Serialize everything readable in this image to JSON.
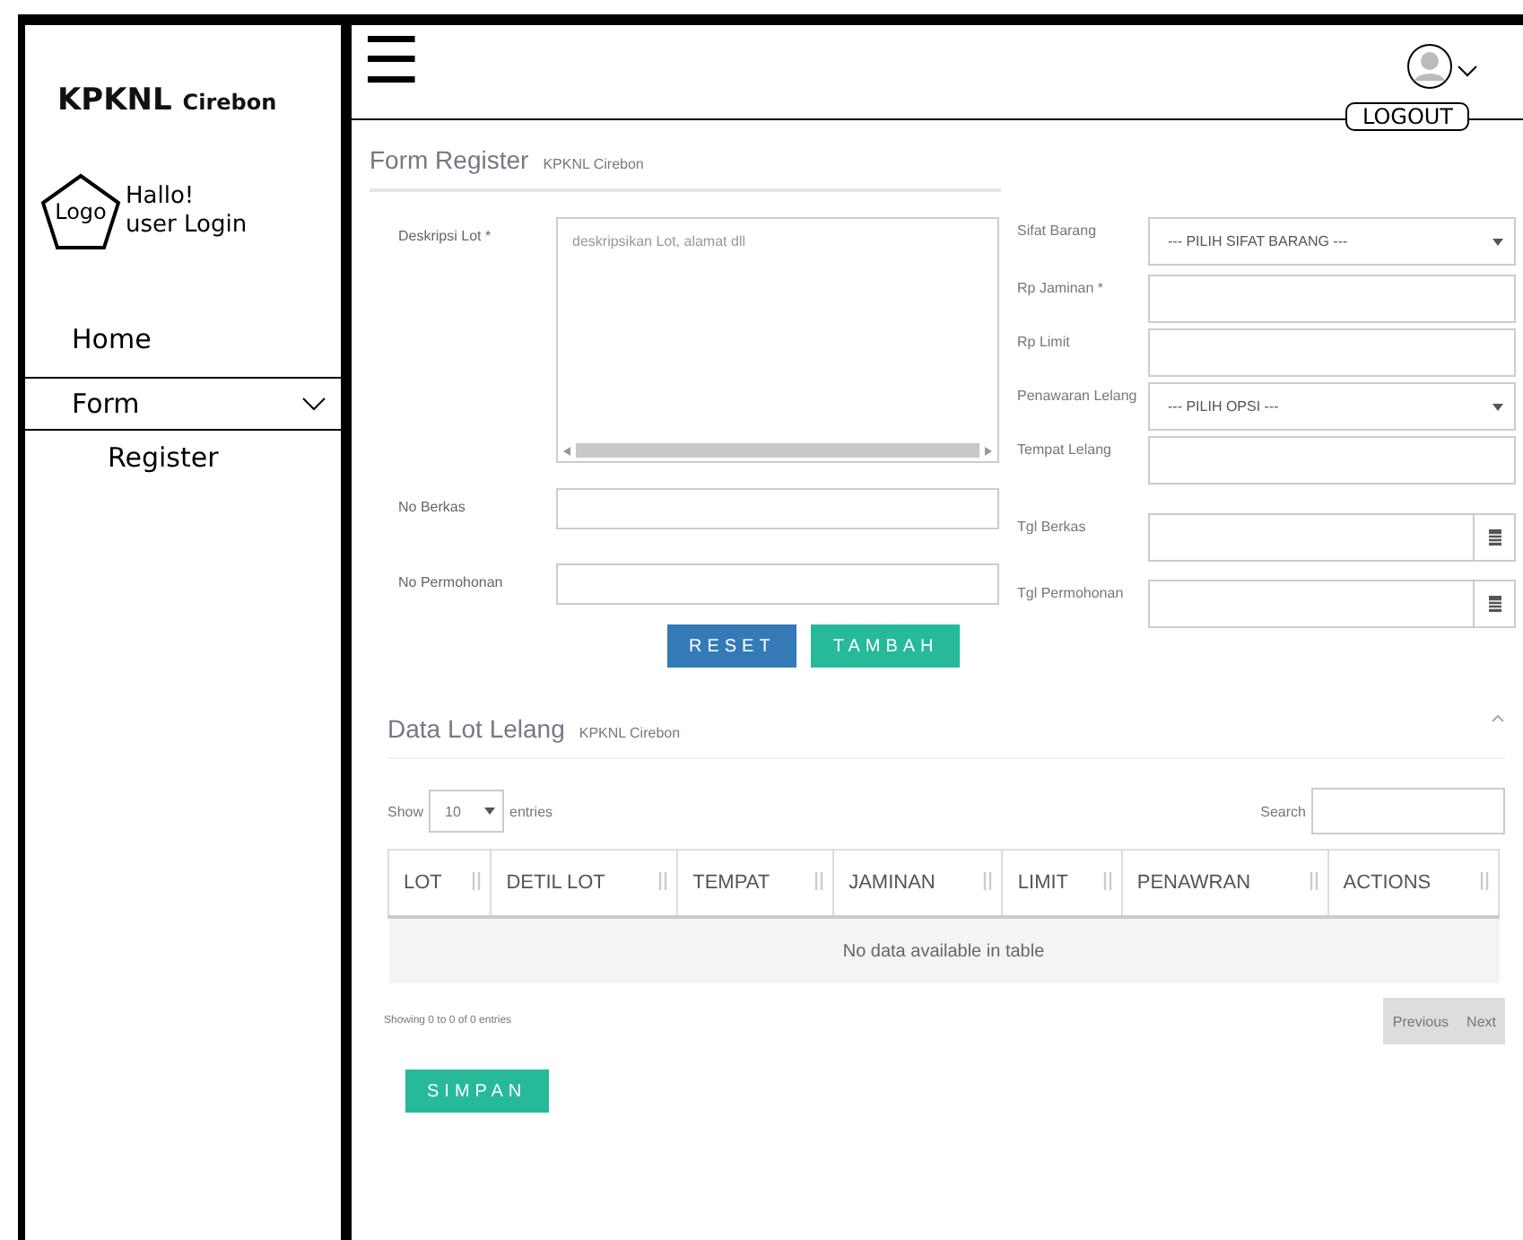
{
  "sidebar": {
    "brand": "KPKNL",
    "brand_sub": "Cirebon",
    "logo": "Logo",
    "greeting": "Hallo!",
    "user": "user Login",
    "items": [
      {
        "label": "Home",
        "expanded": false
      },
      {
        "label": "Form",
        "expanded": true,
        "children": [
          {
            "label": "Register"
          }
        ]
      }
    ]
  },
  "header": {
    "menu_icon": "☰",
    "logout": "LOGOUT"
  },
  "form": {
    "title": "Form Register",
    "subtitle": "KPKNL Cirebon",
    "left_fields": [
      {
        "kind": "textarea",
        "label": "Deskripsi Lot *",
        "placeholder": "deskripsikan Lot, alamat dll"
      },
      {
        "kind": "text",
        "label": "No Berkas"
      },
      {
        "kind": "text",
        "label": "No Permohonan"
      }
    ],
    "right_fields": [
      {
        "kind": "select",
        "label": "Sifat Barang",
        "value": "--- PILIH SIFAT BARANG ---"
      },
      {
        "kind": "text",
        "label": "Rp Jaminan *"
      },
      {
        "kind": "text",
        "label": "Rp Limit"
      },
      {
        "kind": "select",
        "label": "Penawaran Lelang",
        "value": "--- PILIH OPSI ---"
      },
      {
        "kind": "text",
        "label": "Tempat Lelang"
      },
      {
        "kind": "date",
        "label": "Tgl Berkas"
      },
      {
        "kind": "date",
        "label": "Tgl Permohonan"
      }
    ],
    "buttons": [
      {
        "kind": "primary",
        "label": "RESET"
      },
      {
        "kind": "success",
        "label": "TAMBAH"
      }
    ]
  },
  "table": {
    "title": "Data Lot Lelang",
    "subtitle": "KPKNL Cirebon",
    "show": "Show",
    "page_size": "10",
    "entries": "entries",
    "search": "Search",
    "columns": [
      "LOT",
      "DETIL LOT",
      "TEMPAT",
      "JAMINAN",
      "LIMIT",
      "PENAWRAN",
      "ACTIONS"
    ],
    "empty": "No data available in table",
    "info": "Showing 0 to 0 of 0 entries",
    "previous": "Previous",
    "next": "Next"
  },
  "save_button": "SIMPAN"
}
